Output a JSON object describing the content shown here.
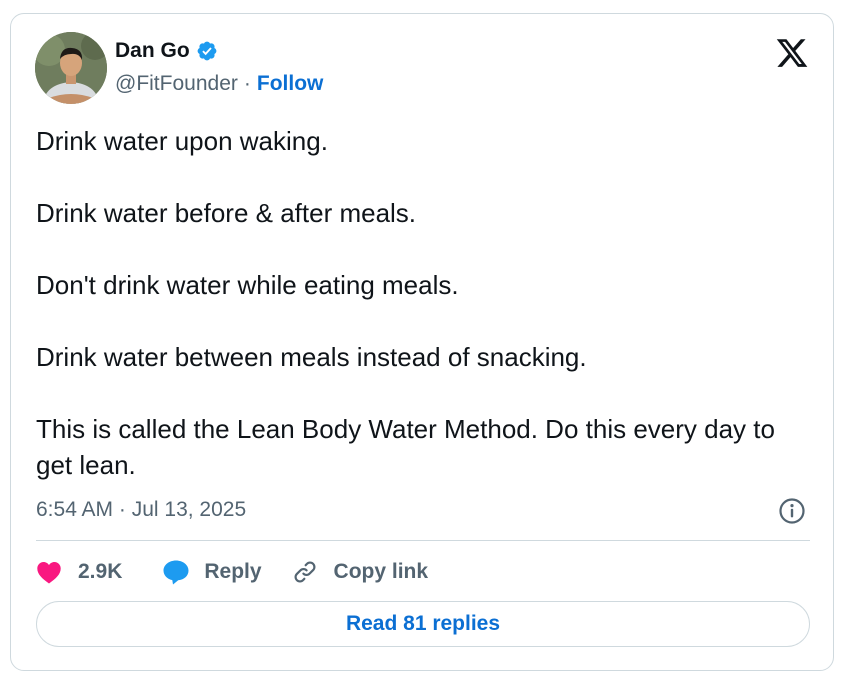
{
  "author": {
    "name": "Dan Go",
    "handle": "@FitFounder",
    "separator": "·",
    "follow_label": "Follow",
    "verified": true,
    "avatar_icon": "profile-photo"
  },
  "tweet": {
    "paragraphs": [
      "Drink water upon waking.",
      "Drink water before & after meals.",
      "Don't drink water while eating meals.",
      "Drink water between meals instead of snacking.",
      "This is called the Lean Body Water Method. Do this every day to get lean."
    ],
    "timestamp": "6:54 AM · Jul 13, 2025"
  },
  "actions": {
    "likes": "2.9K",
    "reply_label": "Reply",
    "copy_link_label": "Copy link"
  },
  "read_replies_label": "Read 81 replies",
  "icons": {
    "brand": "x-logo-icon",
    "verified": "verified-badge-icon",
    "info": "info-icon",
    "like": "heart-icon",
    "reply": "speech-bubble-icon",
    "copy": "link-icon"
  },
  "colors": {
    "link": "#0b6fd3",
    "verified": "#1d9bf0",
    "heart": "#f91880",
    "reply_bubble": "#1d9bf0",
    "muted_text": "#536471",
    "border": "#cfd9de"
  }
}
